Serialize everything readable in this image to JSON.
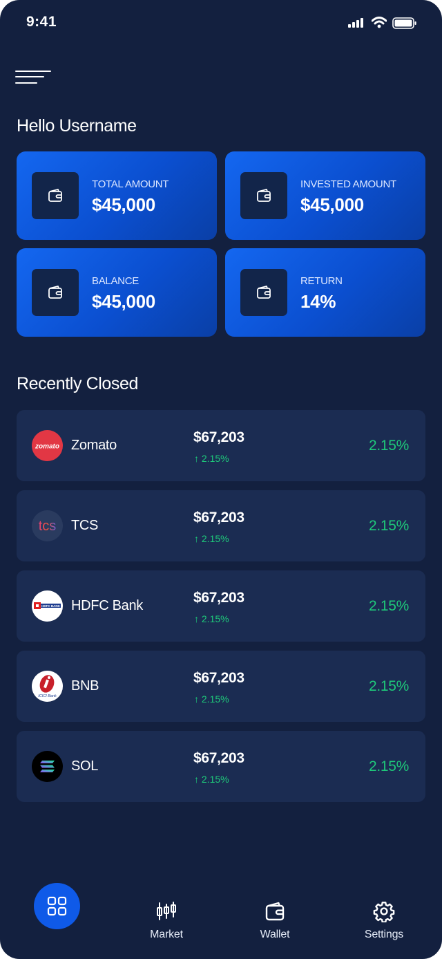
{
  "status_bar": {
    "time": "9:41"
  },
  "greeting": "Hello Username",
  "summary_cards": [
    {
      "label": "TOTAL AMOUNT",
      "value": "$45,000",
      "icon": "wallet-icon"
    },
    {
      "label": "INVESTED AMOUNT",
      "value": "$45,000",
      "icon": "wallet-icon"
    },
    {
      "label": "BALANCE",
      "value": "$45,000",
      "icon": "wallet-icon"
    },
    {
      "label": "RETURN",
      "value": "14%",
      "icon": "wallet-icon"
    }
  ],
  "recent_section_title": "Recently Closed",
  "recent": [
    {
      "name": "Zomato",
      "price": "$67,203",
      "change": "2.15%",
      "percent": "2.15%",
      "logo_text": "zomato"
    },
    {
      "name": "TCS",
      "price": "$67,203",
      "change": "2.15%",
      "percent": "2.15%",
      "logo_text": "tcs"
    },
    {
      "name": "HDFC Bank",
      "price": "$67,203",
      "change": "2.15%",
      "percent": "2.15%",
      "logo_text": "HDFC BANK"
    },
    {
      "name": "BNB",
      "price": "$67,203",
      "change": "2.15%",
      "percent": "2.15%",
      "logo_text": "ICICI Bank"
    },
    {
      "name": "SOL",
      "price": "$67,203",
      "change": "2.15%",
      "percent": "2.15%",
      "logo_text": ""
    }
  ],
  "nav": {
    "home_icon": "grid-icon",
    "items": [
      {
        "label": "Market",
        "icon": "candlestick-icon"
      },
      {
        "label": "Wallet",
        "icon": "wallet-icon"
      },
      {
        "label": "Settings",
        "icon": "gear-icon"
      }
    ]
  },
  "colors": {
    "background": "#13203f",
    "card_blue": "#0f5ae8",
    "row_bg": "#1b2c52",
    "positive": "#1ec97a"
  }
}
